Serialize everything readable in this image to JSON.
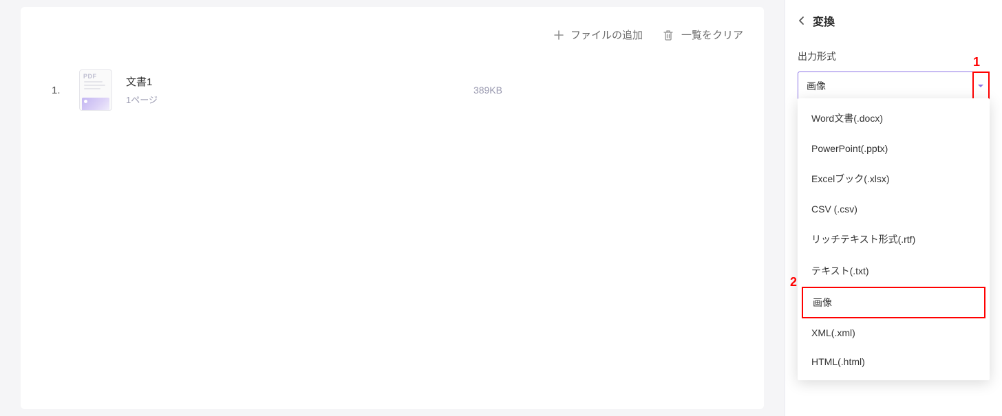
{
  "toolbar": {
    "add_label": "ファイルの追加",
    "clear_label": "一覧をクリア"
  },
  "files": [
    {
      "index": "1.",
      "name": "文書1",
      "pages": "1ページ",
      "size": "389KB",
      "thumb_type": "PDF"
    }
  ],
  "panel": {
    "title": "変換",
    "output_label": "出力形式",
    "selected": "画像",
    "options": [
      "Word文書(.docx)",
      "PowerPoint(.pptx)",
      "Excelブック(.xlsx)",
      "CSV (.csv)",
      "リッチテキスト形式(.rtf)",
      "テキスト(.txt)",
      "画像",
      "XML(.xml)",
      "HTML(.html)"
    ]
  },
  "annotations": {
    "mark1": "1",
    "mark2": "2"
  }
}
